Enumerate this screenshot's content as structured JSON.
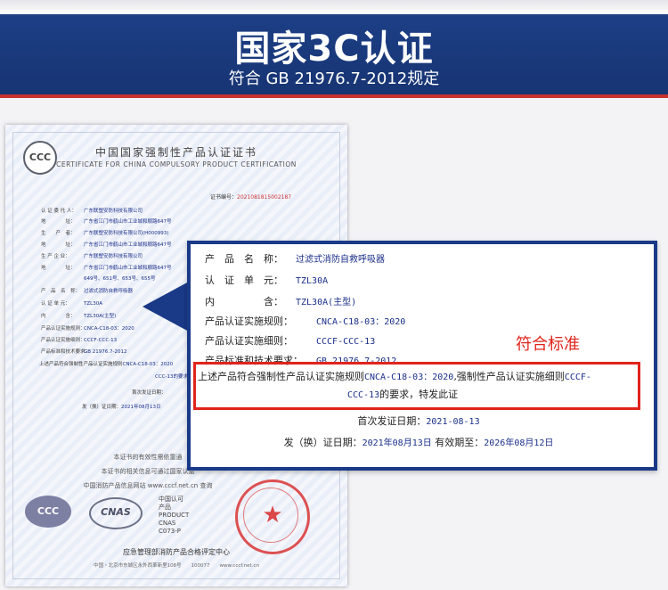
{
  "header": {
    "title": "国家3C认证",
    "subtitle": "符合  GB 21976.7-2012规定"
  },
  "certificate": {
    "logo_text": "CCC",
    "title_cn": "中国国家强制性产品认证证书",
    "title_en": "CERTIFICATE FOR CHINA COMPULSORY PRODUCT CERTIFICATION",
    "number_label": "证书编号：",
    "number_value": "2021081815002187",
    "fields": [
      {
        "label": "认 证 委 托 人：",
        "value": "广东联塑安防科技有限公司"
      },
      {
        "label": "地　　　　址：",
        "value": "广东省江门市鹤山市工业城和顺路647号"
      },
      {
        "label": "生　　产　者：",
        "value": "广东联塑安防科技有限公司(H000993)"
      },
      {
        "label": "地　　　　址：",
        "value": "广东省江门市鹤山市工业城和顺路647号"
      },
      {
        "label": "生 产 企 业：",
        "value": "广东联塑安防科技有限公司"
      },
      {
        "label": "地　　　　址：",
        "value": "广东省江门市鹤山市工业城和顺路647号"
      },
      {
        "label": "",
        "value": "649号、651号、653号、655号"
      },
      {
        "label": "产　品　名　称：",
        "value": "过滤式消防自救呼吸器"
      },
      {
        "label": "认 证 单 元：",
        "value": "TZL30A"
      },
      {
        "label": "内　　　　含：",
        "value": "TZL30A(主型)"
      },
      {
        "label": "产品认证实施规则：",
        "value": "CNCA-C18-03：2020"
      },
      {
        "label": "产品认证实施细则：",
        "value": "CCCF-CCC-13"
      },
      {
        "label": "产品标准和技术要求：",
        "value": "GB 21976.7-2012"
      },
      {
        "label": "上述产品符合强制性产品认证实施规则",
        "value": "CNCA-C18-03：2020"
      },
      {
        "label": "",
        "value": "CCC-13的要求，特发此证"
      },
      {
        "label": "首次发证日期：",
        "value": ""
      },
      {
        "label": "发（换）证日期：",
        "value": "2021年08月13日"
      }
    ],
    "note1": "本证书的有效性需依靠通",
    "note2": "本证书的相关信息可通过国家认监",
    "note3": "中国消防产品信息网站 www.cccf.net.cn 查询",
    "ccc_bottom": "CCC",
    "cnas_logo": "CNAS",
    "cnas_lines": [
      "中国认可",
      "产品",
      "PRODUCT",
      "CNAS C073-P"
    ],
    "footer": "应急管理部消防产品合格评定中心",
    "address": "中国・北京市东城区永外西革新里108号　　100077　　www.cccf.net.cn"
  },
  "zoom": {
    "rows": [
      {
        "label": "产　品　名　称：",
        "value": "过滤式消防自救呼吸器"
      },
      {
        "label": "认　证　单　元：",
        "value": "TZL30A"
      },
      {
        "label": "内　　　　　含：",
        "value": "TZL30A(主型)"
      },
      {
        "label": "产品认证实施规则：",
        "value": "CNCA-C18-03：2020"
      },
      {
        "label": "产品认证实施细则：",
        "value": "CCCF-CCC-13"
      },
      {
        "label": "产品标准和技术要求：",
        "value": "GB 21976.7-2012"
      }
    ],
    "stamp_label": "符合标准",
    "highlight": {
      "pre": "上述产品符合强制性产品认证实施规则",
      "rule": "CNCA-C18-03：2020",
      "mid": ",强制性产品认证实施细则",
      "detail_a": "CCCF-",
      "detail_b": "CCC-13",
      "post": "的要求，特发此证"
    },
    "first_issue_label": "首次发证日期：",
    "first_issue_value": "2021-08-13",
    "issue_label": "发（换）证日期：",
    "issue_value": "2021年08月13日",
    "valid_label": "有效期至：",
    "valid_value": "2026年08月12日"
  }
}
